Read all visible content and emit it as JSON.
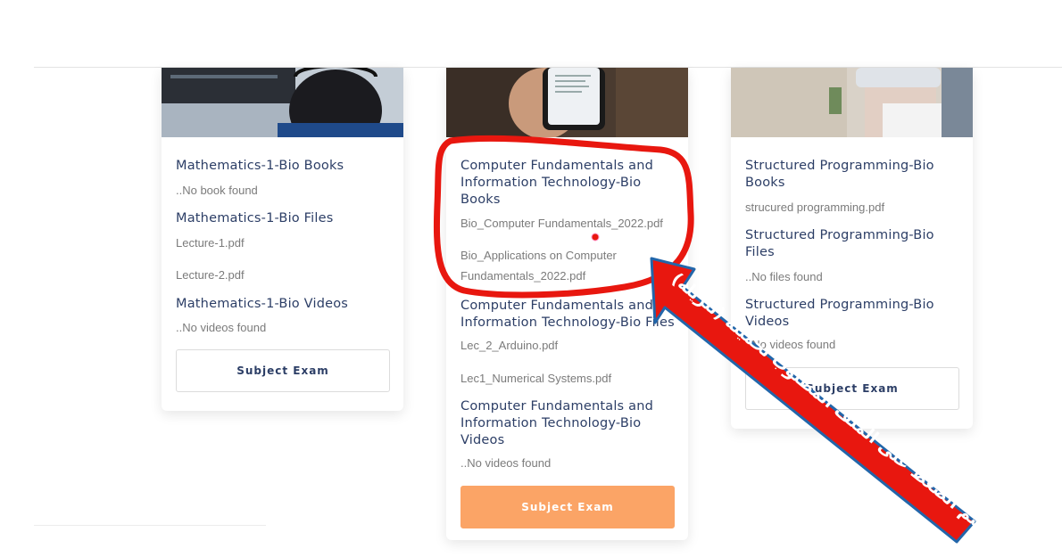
{
  "colors": {
    "heading": "#2c3e66",
    "text": "#7b7b7b",
    "accent_button": "#fba466",
    "annotation_red": "#e8170f"
  },
  "cards": [
    {
      "books_heading": "Mathematics-1-Bio Books",
      "books_items": [
        "..No book found"
      ],
      "files_heading": "Mathematics-1-Bio Files",
      "files_items": [
        "Lecture-1.pdf",
        "Lecture-2.pdf"
      ],
      "videos_heading": "Mathematics-1-Bio Videos",
      "videos_items": [
        "..No videos found"
      ],
      "exam_label": "Subject Exam"
    },
    {
      "books_heading": "Computer Fundamentals and Information Technology-Bio Books",
      "books_items": [
        "Bio_Computer Fundamentals_2022.pdf",
        "Bio_Applications on Computer Fundamentals_2022.pdf"
      ],
      "files_heading": "Computer Fundamentals and Information Technology-Bio Files",
      "files_items": [
        "Lec_2_Arduino.pdf",
        "Lec1_Numerical Systems.pdf"
      ],
      "videos_heading": "Computer Fundamentals and Information Technology-Bio Videos",
      "videos_items": [
        "..No videos found"
      ],
      "exam_label": "Subject Exam"
    },
    {
      "books_heading": "Structured Programming-Bio Books",
      "books_items": [
        "strucured programming.pdf"
      ],
      "files_heading": "Structured Programming-Bio Files",
      "files_items": [
        "..No files found"
      ],
      "videos_heading": "Structured Programming-Bio Videos",
      "videos_items": [
        "..No videos found"
      ],
      "exam_label": "Subject Exam"
    }
  ],
  "annotation": {
    "text": "يتم الضغط على الملف المطلوب تحميله (تنزيله)",
    "icon": "red-arrow-icon"
  }
}
